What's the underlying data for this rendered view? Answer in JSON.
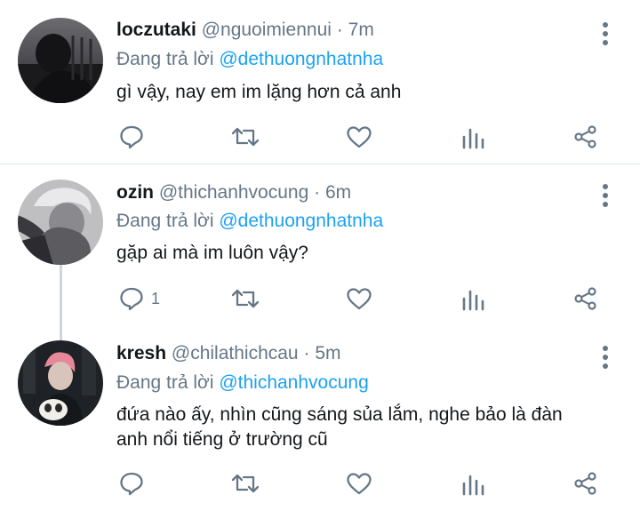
{
  "tweets": [
    {
      "name": "loczutaki",
      "handle": "@nguoimiennui",
      "time": "7m",
      "replying_prefix": "Đang trả lời",
      "replying_to": "@dethuongnhatnha",
      "text": "gì vậy, nay em im lặng hơn cả anh",
      "reply_count": ""
    },
    {
      "name": "ozin",
      "handle": "@thichanhvocung",
      "time": "6m",
      "replying_prefix": "Đang trả lời",
      "replying_to": "@dethuongnhatnha",
      "text": "gặp ai mà im luôn vậy?",
      "reply_count": "1"
    },
    {
      "name": "kresh",
      "handle": "@chilathichcau",
      "time": "5m",
      "replying_prefix": "Đang trả lời",
      "replying_to": "@thichanhvocung",
      "text_line1": "đứa nào ấy,  nhìn cũng sáng sủa lắm, nghe bảo là đàn",
      "text_line2": "anh nổi tiếng ở trường cũ",
      "reply_count": ""
    }
  ],
  "separator": "·",
  "icons": {
    "reply": "reply-icon",
    "retweet": "retweet-icon",
    "like": "like-icon",
    "analytics": "analytics-icon",
    "share": "share-icon",
    "more": "more-options-icon"
  },
  "colors": {
    "name": "#14171a",
    "secondary": "#657786",
    "mention": "#1da1f2",
    "divider": "#e1e8ed",
    "thread_line": "#ccd6dd"
  }
}
